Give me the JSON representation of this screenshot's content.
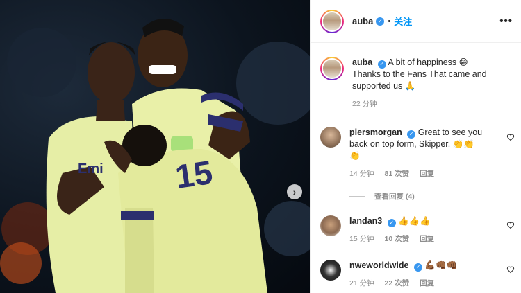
{
  "post": {
    "author": "auba",
    "follow_label": "关注",
    "more_label": "•••",
    "caption_line1": "A bit of happiness 😁",
    "caption_line2": "Thanks to the Fans That came and",
    "caption_line3": "supported us 🙏",
    "time": "22 分钟"
  },
  "photo": {
    "jersey_number": "15",
    "sponsor_text": "Emi"
  },
  "comments": [
    {
      "user": "piersmorgan",
      "verified": true,
      "text_line1": "Great to see you",
      "text_line2": "back on top form, Skipper. 👏👏",
      "text_line3": "👏",
      "time": "14 分钟",
      "likes": "81 次赞",
      "reply": "回复",
      "view_replies": "查看回复 (4)"
    },
    {
      "user": "landan3",
      "verified": true,
      "text": "👍👍👍",
      "time": "15 分钟",
      "likes": "10 次赞",
      "reply": "回复"
    },
    {
      "user": "nweworldwide",
      "verified": true,
      "text": "💪🏾👊🏾👊🏾",
      "time": "21 分钟",
      "likes": "22 次赞",
      "reply": "回复"
    }
  ],
  "colors": {
    "accent": "#0095f6",
    "verified": "#3897f0",
    "jersey": "#e9f0a8",
    "jersey_trim": "#2b2f6e"
  },
  "icons": [
    "verified-icon",
    "heart-icon",
    "chevron-right-icon",
    "more-icon"
  ]
}
